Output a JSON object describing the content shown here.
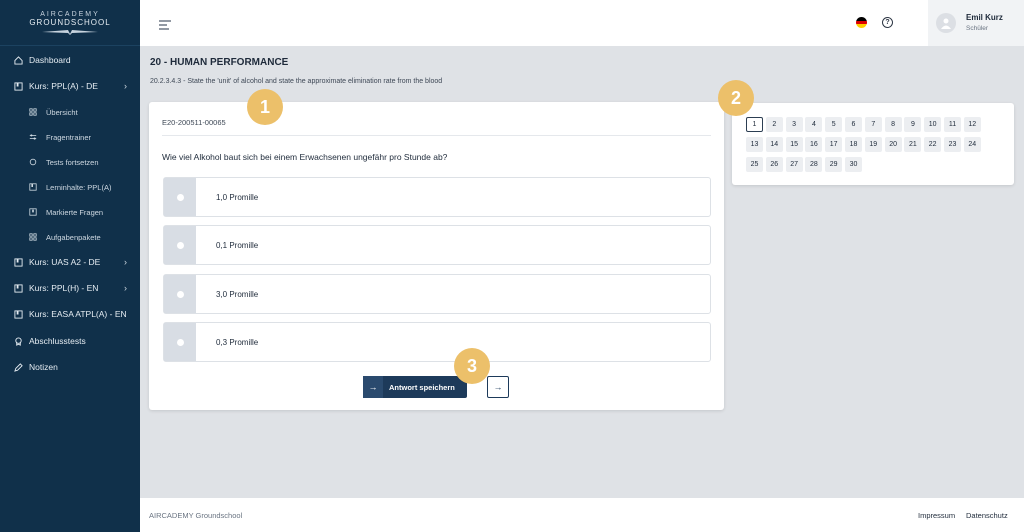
{
  "brand": {
    "line1": "AIRCADEMY",
    "line2": "GROUNDSCHOOL"
  },
  "sidebar": {
    "items": [
      {
        "label": "Dashboard",
        "icon": "home-icon"
      },
      {
        "label": "Kurs: PPL(A) - DE",
        "icon": "book-icon"
      },
      {
        "label": "Übersicht",
        "icon": "grid-icon"
      },
      {
        "label": "Fragentrainer",
        "icon": "sliders-icon"
      },
      {
        "label": "Tests fortsetzen",
        "icon": "refresh-icon"
      },
      {
        "label": "Lerninhalte: PPL(A)",
        "icon": "book-icon"
      },
      {
        "label": "Markierte Fragen",
        "icon": "bookmark-icon"
      },
      {
        "label": "Aufgabenpakete",
        "icon": "grid-icon"
      },
      {
        "label": "Kurs: UAS A2 - DE",
        "icon": "book-icon"
      },
      {
        "label": "Kurs: PPL(H) - EN",
        "icon": "book-icon"
      },
      {
        "label": "Kurs: EASA ATPL(A) - EN",
        "icon": "book-icon"
      },
      {
        "label": "Abschlusstests",
        "icon": "award-icon"
      },
      {
        "label": "Notizen",
        "icon": "pencil-icon"
      }
    ]
  },
  "user": {
    "name": "Emil Kurz",
    "role": "Schüler"
  },
  "page": {
    "title": "20 - HUMAN PERFORMANCE",
    "subtitle": "20.2.3.4.3 - State the 'unit' of alcohol and state the approximate elimination rate from the blood"
  },
  "question": {
    "id": "E20-200511-00065",
    "text": "Wie viel Alkohol baut sich bei einem Erwachsenen ungefähr pro Stunde ab?",
    "options": [
      "1,0 Promille",
      "0,1 Promille",
      "3,0 Promille",
      "0,3 Promille"
    ],
    "save_label": "Antwort speichern"
  },
  "grid": {
    "numbers": [
      "1",
      "2",
      "3",
      "4",
      "5",
      "6",
      "7",
      "8",
      "9",
      "10",
      "11",
      "12",
      "13",
      "14",
      "15",
      "16",
      "17",
      "18",
      "19",
      "20",
      "21",
      "22",
      "23",
      "24",
      "25",
      "26",
      "27",
      "28",
      "29",
      "30"
    ],
    "active": "1"
  },
  "badges": [
    "1",
    "2",
    "3"
  ],
  "footer": {
    "brand": "AIRCADEMY Groundschool",
    "impressum": "Impressum",
    "datenschutz": "Datenschutz"
  },
  "colors": {
    "sidebar": "#10304a",
    "accent": "#1d3a5a",
    "badge": "#ecc06a"
  }
}
